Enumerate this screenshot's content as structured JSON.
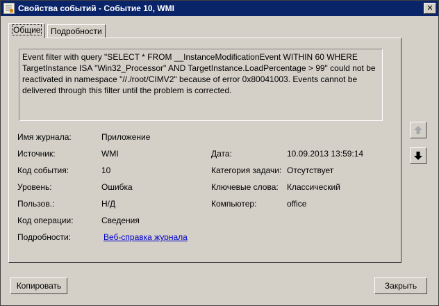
{
  "window": {
    "title": "Свойства событий - Событие 10, WMI",
    "close_label": "✕"
  },
  "tabs": [
    {
      "label": "Общие"
    },
    {
      "label": "Подробности"
    }
  ],
  "description": "Event filter with query \"SELECT * FROM __InstanceModificationEvent WITHIN 60 WHERE TargetInstance ISA \"Win32_Processor\" AND TargetInstance.LoadPercentage > 99\" could not be reactivated in namespace \"//./root/CIMV2\" because of error 0x80041003. Events cannot be delivered through this filter until the problem is corrected.",
  "fields": {
    "log_name": {
      "label": "Имя журнала:",
      "value": "Приложение"
    },
    "source": {
      "label": "Источник:",
      "value": "WMI"
    },
    "date": {
      "label": "Дата:",
      "value": "10.09.2013 13:59:14"
    },
    "event_id": {
      "label": "Код события:",
      "value": "10"
    },
    "task_category": {
      "label": "Категория задачи:",
      "value": "Отсутствует"
    },
    "level": {
      "label": "Уровень:",
      "value": "Ошибка"
    },
    "keywords": {
      "label": "Ключевые слова:",
      "value": "Классический"
    },
    "user": {
      "label": "Пользов.:",
      "value": "Н/Д"
    },
    "computer": {
      "label": "Компьютер:",
      "value": "office"
    },
    "opcode": {
      "label": "Код операции:",
      "value": "Сведения"
    },
    "more_info": {
      "label": "Подробности:",
      "value": "Веб-справка журнала"
    }
  },
  "buttons": {
    "copy": "Копировать",
    "close": "Закрыть"
  },
  "nav": {
    "up_icon": "arrow-up-icon",
    "down_icon": "arrow-down-icon"
  }
}
